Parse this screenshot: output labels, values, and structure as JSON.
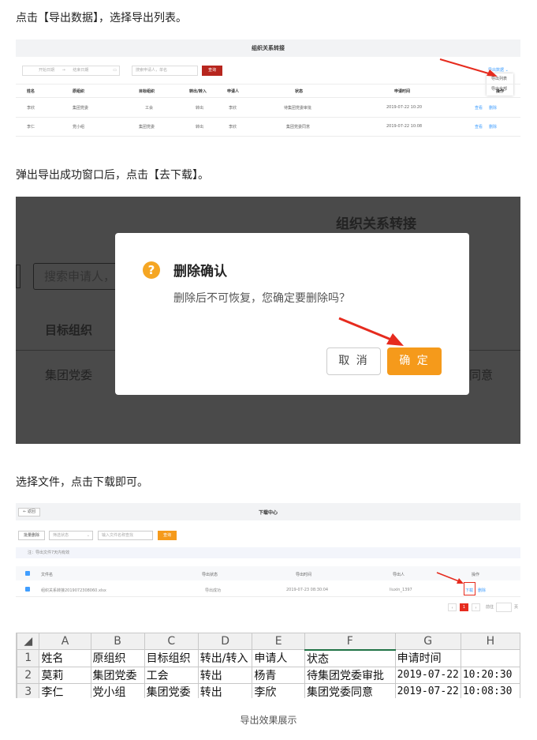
{
  "captions": {
    "step1": "点击【导出数据】，选择导出列表。",
    "step2": "弹出导出成功窗口后，点击【去下载】。",
    "step3": "选择文件，点击下载即可。",
    "footer": "导出效果展示"
  },
  "shot1": {
    "title": "组织关系转接",
    "start_date_placeholder": "开始日期",
    "to": "→",
    "end_date_placeholder": "结束日期",
    "search_placeholder": "搜索申请人，单名",
    "query_button": "查询",
    "export_label": "导出数据",
    "export_menu": [
      "导出列表",
      "导出全部"
    ],
    "columns": [
      "姓名",
      "原组织",
      "目标组织",
      "转出/转入",
      "申请人",
      "状态",
      "申请时间",
      "操作"
    ],
    "rows": [
      {
        "name": "李欣",
        "from": "集团党委",
        "to": "工会",
        "dir": "转出",
        "applicant": "李欣",
        "status": "待集团党委审批",
        "time": "2019-07-22 10:20",
        "view": "查看",
        "del": "删除"
      },
      {
        "name": "李仁",
        "from": "党小组",
        "to": "集团党委",
        "dir": "转出",
        "applicant": "李欣",
        "status": "集团党委同意",
        "time": "2019-07-22 10:08",
        "view": "查看",
        "del": "删除"
      }
    ]
  },
  "shot2": {
    "bg_title": "组织关系转接",
    "bg_search": "搜索申请人，",
    "bg_col": "目标组织",
    "bg_cell": "集团党委",
    "bg_right": "同意",
    "dialog_icon": "?",
    "dialog_title": "删除确认",
    "dialog_message": "删除后不可恢复，您确定要删除吗？",
    "cancel": "取 消",
    "confirm": "确 定",
    "accent": "#f59a1b"
  },
  "shot3": {
    "back": "← 返回",
    "title": "下载中心",
    "batch_delete": "批量删除",
    "filter_placeholder": "筛选状态",
    "file_search_placeholder": "输入文件名称查找",
    "query": "查询",
    "notice": "注：导出文件7天内有效",
    "columns": [
      "文件名",
      "导出状态",
      "导出时间",
      "导出人",
      "操作"
    ],
    "row": {
      "file": "组织关系转接2019072308060.xlsx",
      "status": "导出成功",
      "time": "2019-07-23 08:30:04",
      "user": "liuxin_1397",
      "download": "下载",
      "delete": "删除"
    },
    "page": "1",
    "goto": "前往",
    "page_suffix": "页"
  },
  "sheet": {
    "col_headers": [
      "A",
      "B",
      "C",
      "D",
      "E",
      "F",
      "G",
      "H"
    ],
    "rows": [
      {
        "n": "1",
        "cells": [
          "姓名",
          "原组织",
          "目标组织",
          "转出/转入",
          "申请人",
          "状态",
          "申请时间",
          ""
        ]
      },
      {
        "n": "2",
        "cells": [
          "莫莉",
          "集团党委",
          "工会",
          "转出",
          "杨青",
          "待集团党委审批",
          "2019-07-22",
          "10:20:30"
        ]
      },
      {
        "n": "3",
        "cells": [
          "李仁",
          "党小组",
          "集团党委",
          "转出",
          "李欣",
          "集团党委同意",
          "2019-07-22",
          "10:08:30"
        ]
      }
    ]
  }
}
